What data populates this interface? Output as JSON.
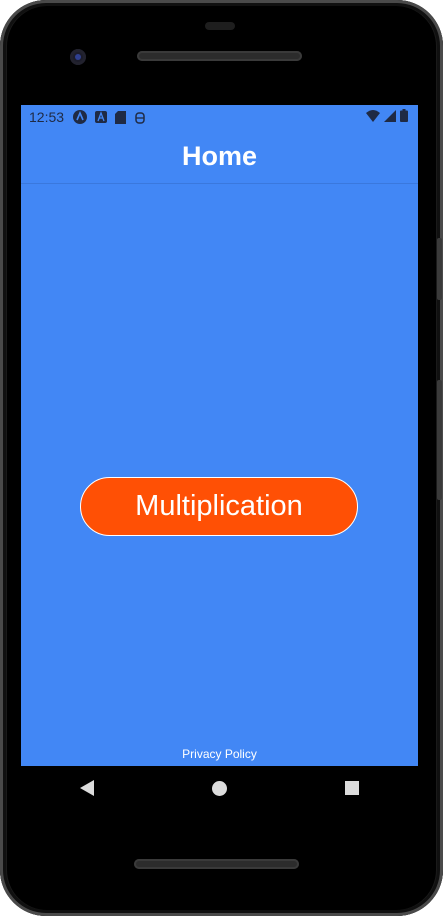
{
  "status_bar": {
    "time": "12:53",
    "left_icons": [
      "react-icon",
      "a-app-icon",
      "sd-card-icon",
      "debug-icon"
    ],
    "right_icons": [
      "wifi-icon",
      "cell-signal-icon",
      "battery-icon"
    ]
  },
  "header": {
    "title": "Home"
  },
  "main": {
    "button_label": "Multiplication"
  },
  "footer": {
    "privacy_label": "Privacy Policy"
  },
  "nav_bar": {
    "items": [
      "back-icon",
      "home-icon",
      "recents-icon"
    ]
  },
  "colors": {
    "screen_bg": "#4287f5",
    "button_bg": "#ff5005",
    "text": "#ffffff"
  }
}
